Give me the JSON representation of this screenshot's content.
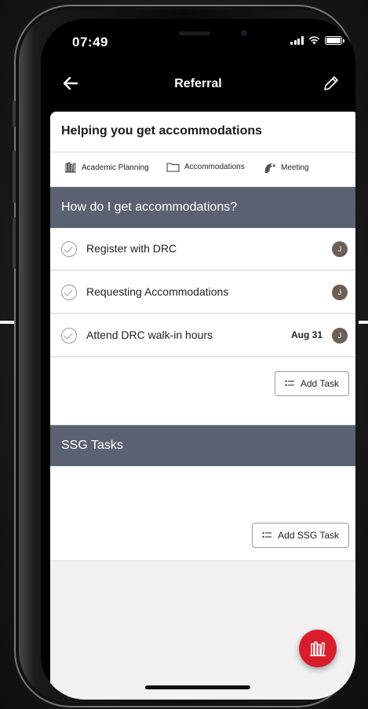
{
  "status_bar": {
    "time": "07:49"
  },
  "nav": {
    "title": "Referral"
  },
  "card": {
    "title": "Helping you get accommodations"
  },
  "tabs": [
    {
      "label": "Academic Planning",
      "icon": "books-icon"
    },
    {
      "label": "Accommodations",
      "icon": "folder-icon"
    },
    {
      "label": "Meeting",
      "icon": "meeting-icon"
    }
  ],
  "accommodations_section": {
    "heading": "How do I get accommodations?",
    "tasks": [
      {
        "label": "Register with DRC",
        "date": "",
        "assignee": "J"
      },
      {
        "label": "Requesting Accommodations",
        "date": "",
        "assignee": "J"
      },
      {
        "label": "Attend DRC walk-in hours",
        "date": "Aug 31",
        "assignee": "J"
      }
    ],
    "add_button": "Add Task"
  },
  "ssg_section": {
    "heading": "SSG Tasks",
    "add_button": "Add SSG Task"
  },
  "colors": {
    "section_header": "#5a6170",
    "fab": "#d81e2c",
    "avatar": "#6b5f58"
  }
}
